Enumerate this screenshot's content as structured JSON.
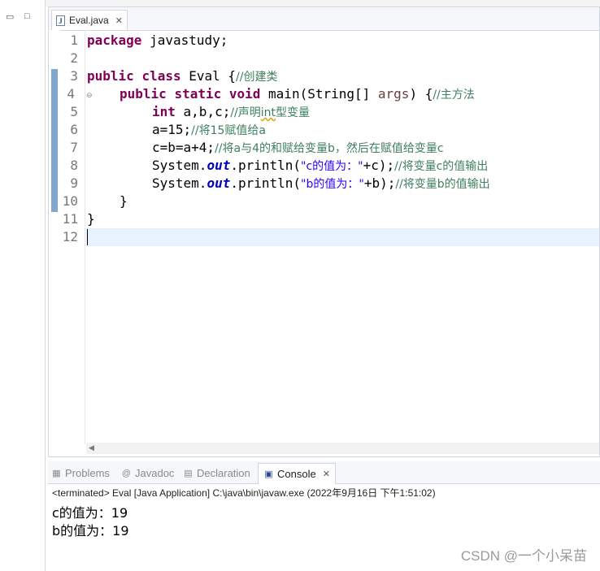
{
  "editor": {
    "tab_title": "Eval.java",
    "tab_icon": "java-file-icon",
    "lines": [
      {
        "no": "1"
      },
      {
        "no": "2"
      },
      {
        "no": "3"
      },
      {
        "no": "4"
      },
      {
        "no": "5"
      },
      {
        "no": "6"
      },
      {
        "no": "7"
      },
      {
        "no": "8"
      },
      {
        "no": "9"
      },
      {
        "no": "10"
      },
      {
        "no": "11"
      },
      {
        "no": "12"
      }
    ],
    "code": {
      "l1_kw": "package",
      "l1_rest": " javastudy;",
      "l3_kw1": "public",
      "l3_kw2": "class",
      "l3_rest": " Eval {",
      "l3_cm": "//创建类",
      "l4_kw1": "public",
      "l4_kw2": "static",
      "l4_kw3": "void",
      "l4_rest1": " main(String[] ",
      "l4_param": "args",
      "l4_rest2": ") {",
      "l4_cm": "//主方法",
      "l5_kw": "int",
      "l5_rest": " a,b,c;",
      "l5_cm1": "//声明",
      "l5_cm_sq": "int",
      "l5_cm2": "型变量",
      "l6_code": "a=15;",
      "l6_cm": "//将15赋值给a",
      "l7_code": "c=b=a+4;",
      "l7_cm": "//将a与4的和赋给变量b，然后在赋值给变量c",
      "l8_pre": "System.",
      "l8_fld": "out",
      "l8_mid": ".println(",
      "l8_str": "\"c的值为：\"",
      "l8_post": "+c);",
      "l8_cm": "//将变量c的值输出",
      "l9_pre": "System.",
      "l9_fld": "out",
      "l9_mid": ".println(",
      "l9_str": "\"b的值为：\"",
      "l9_post": "+b);",
      "l9_cm": "//将变量b的值输出",
      "l10": "}",
      "l11": "}"
    }
  },
  "console": {
    "tabs": [
      {
        "label": "Problems",
        "icon": "problems-icon"
      },
      {
        "label": "Javadoc",
        "icon": "at-icon"
      },
      {
        "label": "Declaration",
        "icon": "declaration-icon"
      },
      {
        "label": "Console",
        "icon": "console-icon"
      }
    ],
    "terminated": "<terminated> Eval [Java Application] C:\\java\\bin\\javaw.exe (2022年9月16日 下午1:51:02)",
    "output": [
      "c的值为：19",
      "b的值为：19"
    ]
  },
  "watermark": "CSDN @一个小呆苗"
}
